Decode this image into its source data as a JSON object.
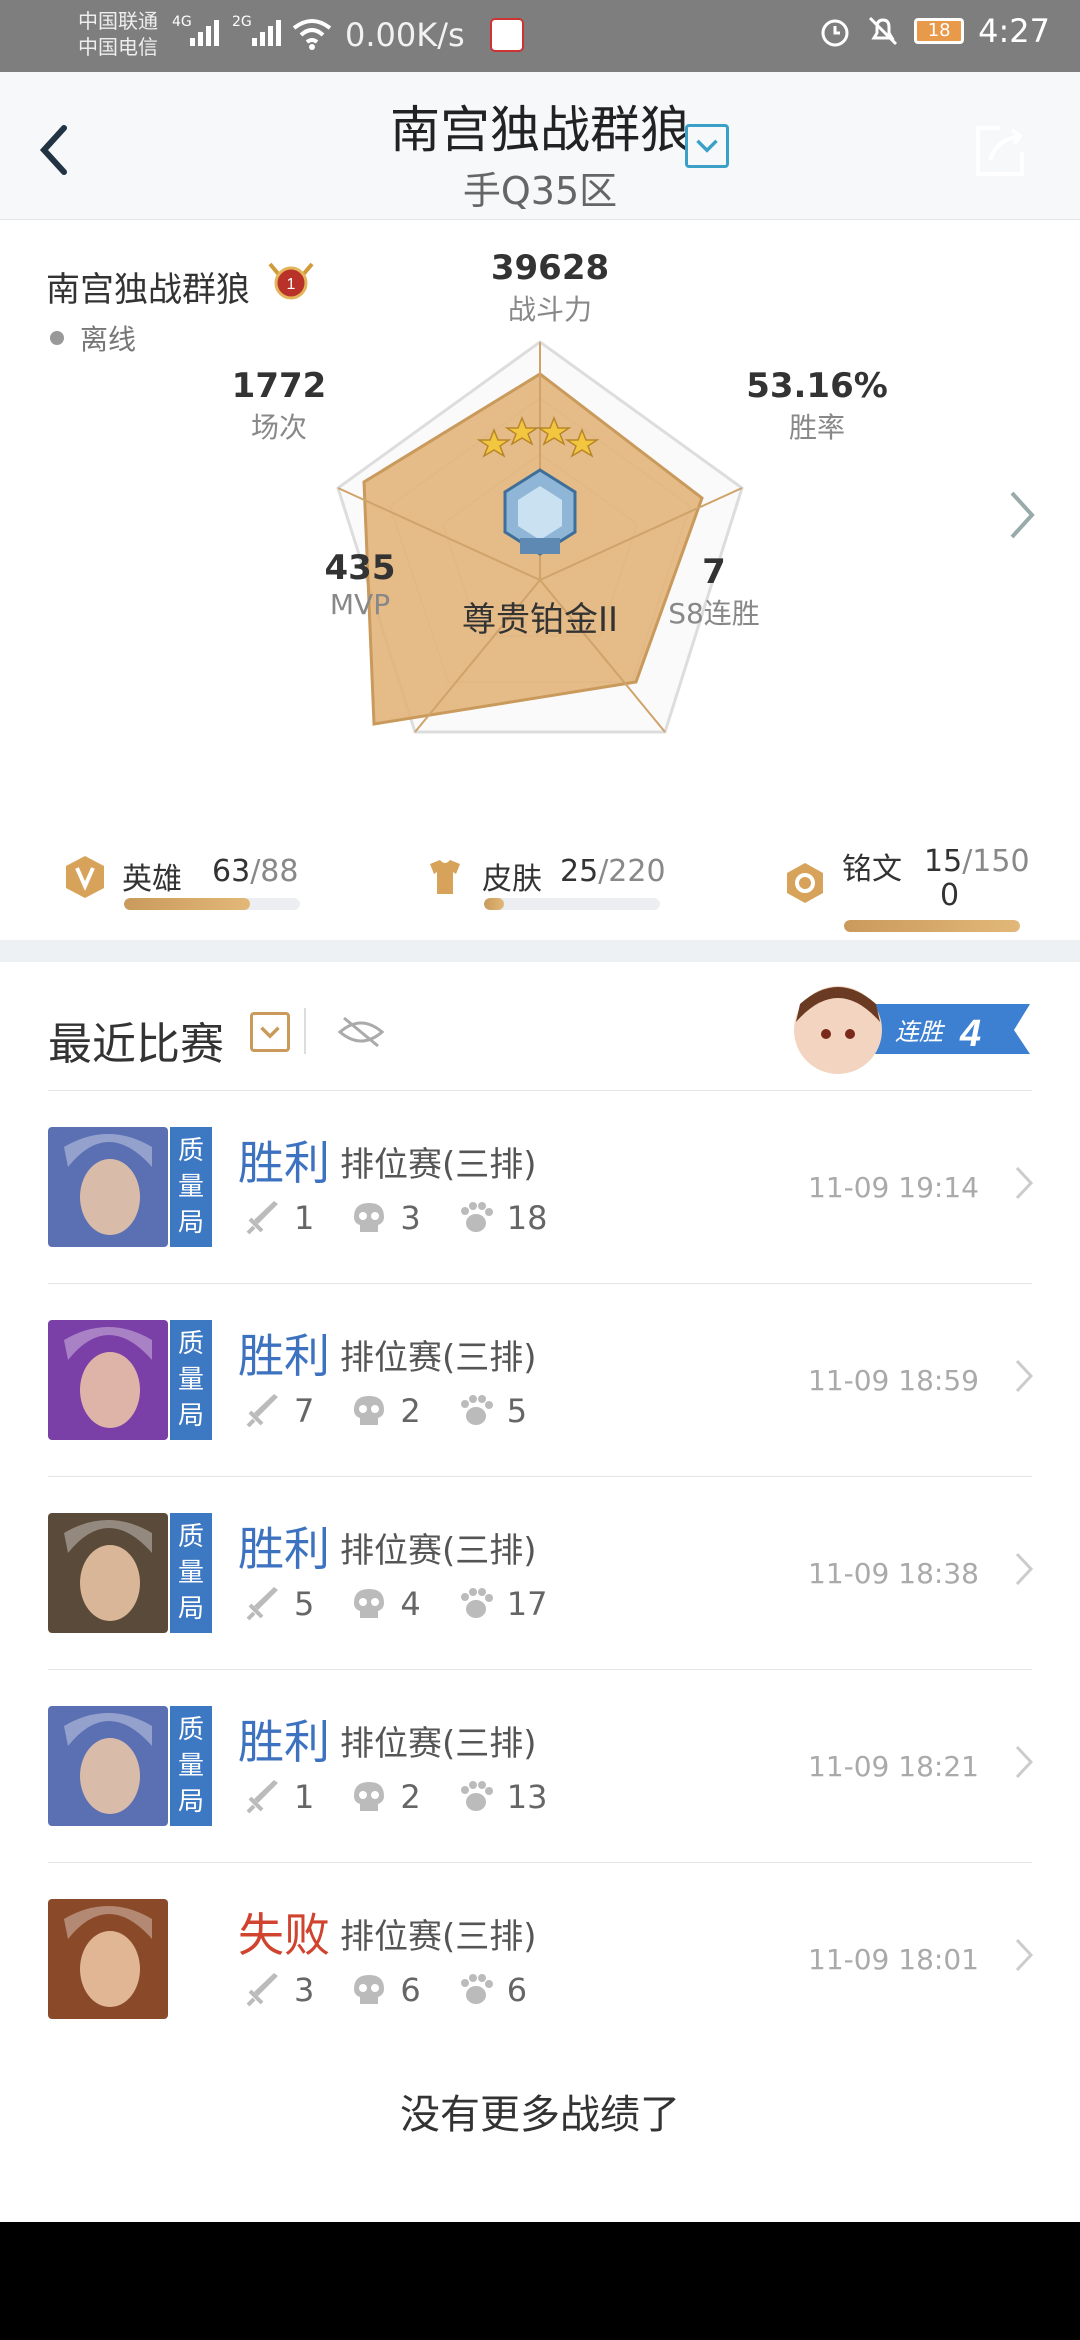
{
  "status_bar": {
    "carrier1": "中国联通",
    "carrier2": "中国电信",
    "sig1": "4G",
    "sig2": "2G",
    "net_speed": "0.00K/s",
    "battery": "18",
    "time": "4:27"
  },
  "header": {
    "title": "南宫独战群狼",
    "subtitle": "手Q35区"
  },
  "profile": {
    "name": "南宫独战群狼",
    "badge_number": "1",
    "status": "离线",
    "rank_name": "尊贵铂金II",
    "stats": {
      "power": {
        "value": "39628",
        "label": "战斗力"
      },
      "games": {
        "value": "1772",
        "label": "场次"
      },
      "winrate": {
        "value": "53.16%",
        "label": "胜率"
      },
      "mvp": {
        "value": "435",
        "label": "MVP"
      },
      "streak": {
        "value": "7",
        "label": "S8连胜"
      }
    },
    "counts": {
      "heroes": {
        "label": "英雄",
        "owned": "63",
        "total": "/88",
        "fraction": 0.716
      },
      "skins": {
        "label": "皮肤",
        "owned": "25",
        "total": "/220",
        "fraction": 0.114
      },
      "inscriptions": {
        "label": "铭文",
        "owned": "15",
        "total": "/150",
        "extra": "0",
        "fraction": 1.0
      }
    }
  },
  "recent": {
    "title": "最近比赛",
    "streak_label": "连胜",
    "streak_count": "4",
    "matches": [
      {
        "result": "胜利",
        "win": true,
        "tag": [
          "质",
          "量",
          "局"
        ],
        "mode": "排位赛(三排)",
        "kills": "1",
        "deaths": "3",
        "assists": "18",
        "time": "11-09 19:14",
        "hero_color": "#5b6fb3"
      },
      {
        "result": "胜利",
        "win": true,
        "tag": [
          "质",
          "量",
          "局"
        ],
        "mode": "排位赛(三排)",
        "kills": "7",
        "deaths": "2",
        "assists": "5",
        "time": "11-09 18:59",
        "hero_color": "#7b3fa8"
      },
      {
        "result": "胜利",
        "win": true,
        "tag": [
          "质",
          "量",
          "局"
        ],
        "mode": "排位赛(三排)",
        "kills": "5",
        "deaths": "4",
        "assists": "17",
        "time": "11-09 18:38",
        "hero_color": "#5a4a3a"
      },
      {
        "result": "胜利",
        "win": true,
        "tag": [
          "质",
          "量",
          "局"
        ],
        "mode": "排位赛(三排)",
        "kills": "1",
        "deaths": "2",
        "assists": "13",
        "time": "11-09 18:21",
        "hero_color": "#5b6fb3"
      },
      {
        "result": "失败",
        "win": false,
        "tag": null,
        "mode": "排位赛(三排)",
        "kills": "3",
        "deaths": "6",
        "assists": "6",
        "time": "11-09 18:01",
        "hero_color": "#8a4a2a"
      }
    ],
    "no_more": "没有更多战绩了"
  },
  "colors": {
    "win": "#3d72c0",
    "lose": "#d0442f",
    "gold": "#c99a5b"
  }
}
